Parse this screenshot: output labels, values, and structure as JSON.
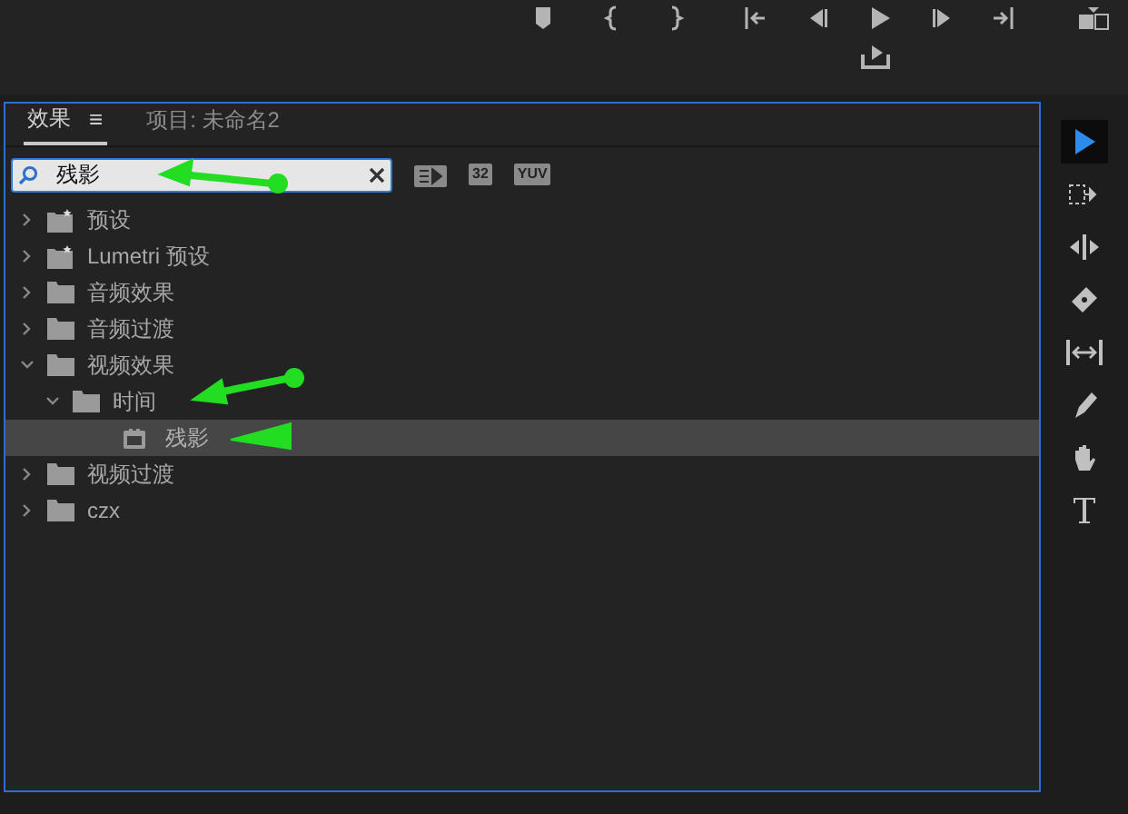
{
  "tabs": [
    {
      "label": "效果",
      "selected": true,
      "menu": "≡"
    },
    {
      "label": "项目: 未命名2",
      "selected": false
    }
  ],
  "search": {
    "value": "残影"
  },
  "filter_badges": [
    "32",
    "YUV"
  ],
  "tree": [
    {
      "label": "预设",
      "kind": "preset",
      "expanded": false
    },
    {
      "label": "Lumetri 预设",
      "kind": "preset",
      "expanded": false
    },
    {
      "label": "音频效果",
      "kind": "folder",
      "expanded": false
    },
    {
      "label": "音频过渡",
      "kind": "folder",
      "expanded": false
    },
    {
      "label": "视频效果",
      "kind": "folder",
      "expanded": true,
      "children": [
        {
          "label": "时间",
          "kind": "folder",
          "expanded": true,
          "children": [
            {
              "label": "残影",
              "kind": "effect",
              "selected": true
            }
          ]
        }
      ]
    },
    {
      "label": "视频过渡",
      "kind": "folder",
      "expanded": false
    },
    {
      "label": "czx",
      "kind": "folder",
      "expanded": false
    }
  ],
  "tools": [
    {
      "kind": "select",
      "selected": true
    },
    {
      "kind": "track-select",
      "selected": false
    },
    {
      "kind": "ripple",
      "selected": false
    },
    {
      "kind": "razor",
      "selected": false
    },
    {
      "kind": "slip",
      "selected": false
    },
    {
      "kind": "pen",
      "selected": false
    },
    {
      "kind": "hand",
      "selected": false
    },
    {
      "kind": "type",
      "selected": false
    }
  ]
}
